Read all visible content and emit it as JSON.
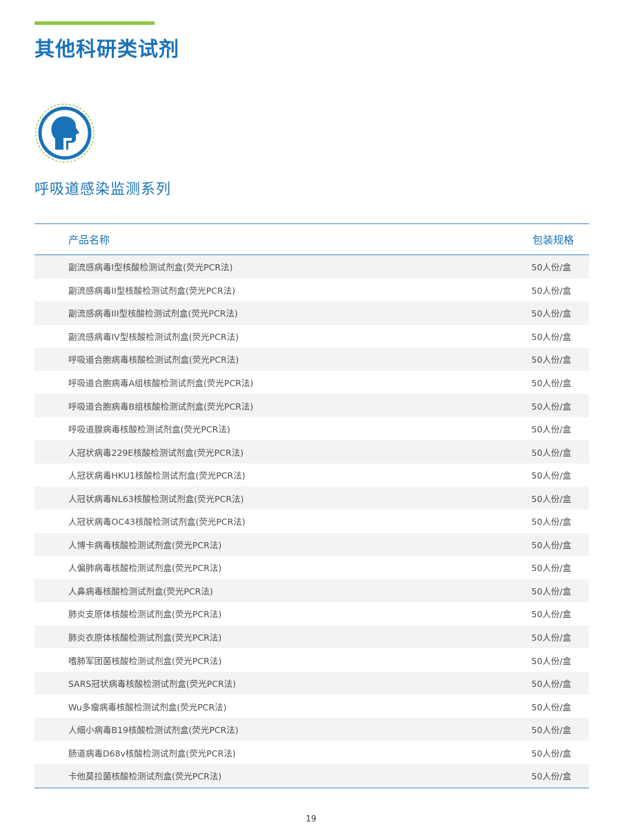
{
  "header": {
    "title": "其他科研类试剂"
  },
  "section": {
    "icon": "respiratory-head-icon",
    "title": "呼吸道感染监测系列"
  },
  "table": {
    "columns": [
      "产品名称",
      "包装规格"
    ],
    "rows": [
      {
        "name": "副流感病毒I型核酸检测试剂盒(荧光PCR法)",
        "pack": "50人份/盒"
      },
      {
        "name": "副流感病毒II型核酸检测试剂盒(荧光PCR法)",
        "pack": "50人份/盒"
      },
      {
        "name": "副流感病毒III型核酸检测试剂盒(荧光PCR法)",
        "pack": "50人份/盒"
      },
      {
        "name": "副流感病毒IV型核酸检测试剂盒(荧光PCR法)",
        "pack": "50人份/盒"
      },
      {
        "name": "呼吸道合胞病毒核酸检测试剂盒(荧光PCR法)",
        "pack": "50人份/盒"
      },
      {
        "name": "呼吸道合胞病毒A组核酸检测试剂盒(荧光PCR法)",
        "pack": "50人份/盒"
      },
      {
        "name": "呼吸道合胞病毒B组核酸检测试剂盒(荧光PCR法)",
        "pack": "50人份/盒"
      },
      {
        "name": "呼吸道腺病毒核酸检测试剂盒(荧光PCR法)",
        "pack": "50人份/盒"
      },
      {
        "name": "人冠状病毒229E核酸检测试剂盒(荧光PCR法)",
        "pack": "50人份/盒"
      },
      {
        "name": "人冠状病毒HKU1核酸检测试剂盒(荧光PCR法)",
        "pack": "50人份/盒"
      },
      {
        "name": "人冠状病毒NL63核酸检测试剂盒(荧光PCR法)",
        "pack": "50人份/盒"
      },
      {
        "name": "人冠状病毒OC43核酸检测试剂盒(荧光PCR法)",
        "pack": "50人份/盒"
      },
      {
        "name": "人博卡病毒核酸检测试剂盒(荧光PCR法)",
        "pack": "50人份/盒"
      },
      {
        "name": "人偏肺病毒核酸检测试剂盒(荧光PCR法)",
        "pack": "50人份/盒"
      },
      {
        "name": "人鼻病毒核酸检测试剂盒(荧光PCR法)",
        "pack": "50人份/盒"
      },
      {
        "name": "肺炎支原体核酸检测试剂盒(荧光PCR法)",
        "pack": "50人份/盒"
      },
      {
        "name": "肺炎衣原体核酸检测试剂盒(荧光PCR法)",
        "pack": "50人份/盒"
      },
      {
        "name": "嗜肺军团菌核酸检测试剂盒(荧光PCR法)",
        "pack": "50人份/盒"
      },
      {
        "name": "SARS冠状病毒核酸检测试剂盒(荧光PCR法)",
        "pack": "50人份/盒"
      },
      {
        "name": "Wu多瘤病毒核酸检测试剂盒(荧光PCR法)",
        "pack": "50人份/盒"
      },
      {
        "name": "人细小病毒B19核酸检测试剂盒(荧光PCR法)",
        "pack": "50人份/盒"
      },
      {
        "name": "肠道病毒D68v核酸检测试剂盒(荧光PCR法)",
        "pack": "50人份/盒"
      },
      {
        "name": "卡他莫拉菌核酸检测试剂盒(荧光PCR法)",
        "pack": "50人份/盒"
      }
    ]
  },
  "footer": {
    "page_number": "19"
  },
  "colors": {
    "brand_blue": "#1a73b8",
    "accent_green": "#8cc63f",
    "row_shade": "#f3f3f3",
    "text_gray": "#4d4d4d"
  }
}
